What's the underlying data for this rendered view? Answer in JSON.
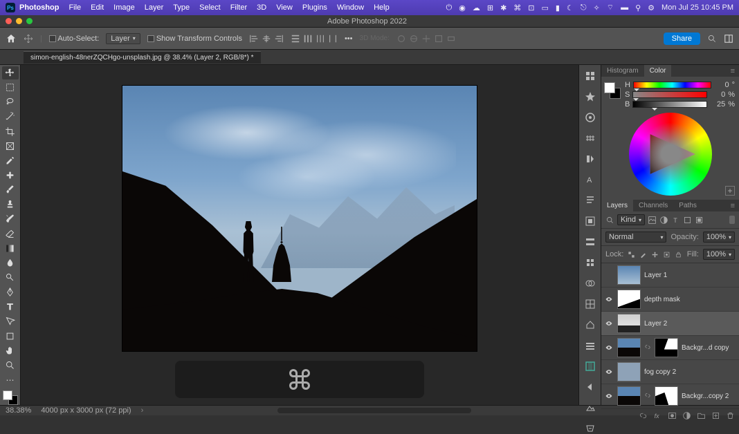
{
  "menubar": {
    "app": "Photoshop",
    "items": [
      "File",
      "Edit",
      "Image",
      "Layer",
      "Type",
      "Select",
      "Filter",
      "3D",
      "View",
      "Plugins",
      "Window",
      "Help"
    ],
    "clock": "Mon Jul 25  10:45 PM"
  },
  "titlebar": {
    "label": "Adobe Photoshop 2022"
  },
  "optbar": {
    "auto_select": "Auto-Select:",
    "target": "Layer",
    "show_transform": "Show Transform Controls",
    "mode3d": "3D Mode:",
    "share": "Share"
  },
  "tab": "simon-english-48nerZQCHgo-unsplash.jpg @ 38.4% (Layer 2, RGB/8*) *",
  "panel_tabs": {
    "histogram": "Histogram",
    "color": "Color",
    "layers": "Layers",
    "channels": "Channels",
    "paths": "Paths"
  },
  "color": {
    "h": {
      "label": "H",
      "val": "0",
      "unit": "°"
    },
    "s": {
      "label": "S",
      "val": "0",
      "unit": "%"
    },
    "b": {
      "label": "B",
      "val": "25",
      "unit": "%"
    }
  },
  "layers": {
    "kind": "Kind",
    "blend": "Normal",
    "opacity_label": "Opacity:",
    "opacity_val": "100%",
    "fill_label": "Fill:",
    "fill_val": "100%",
    "lock_label": "Lock:",
    "items": [
      {
        "name": "Layer 1",
        "vis": false,
        "sel": false,
        "thumb": "sky",
        "mask": null
      },
      {
        "name": "depth mask",
        "vis": true,
        "sel": false,
        "thumb": "depth",
        "mask": null
      },
      {
        "name": "Layer 2",
        "vis": true,
        "sel": true,
        "thumb": "l2",
        "mask": null
      },
      {
        "name": "Backgr...d copy",
        "vis": true,
        "sel": false,
        "thumb": "img",
        "mask": "mask",
        "linked": true
      },
      {
        "name": "fog copy 2",
        "vis": true,
        "sel": false,
        "thumb": "fog",
        "mask": null
      },
      {
        "name": "Backgr...copy 2",
        "vis": true,
        "sel": false,
        "thumb": "img",
        "mask": "mask2",
        "linked": true
      }
    ]
  },
  "status": {
    "zoom": "38.38%",
    "dims": "4000 px x 3000 px (72 ppi)"
  }
}
